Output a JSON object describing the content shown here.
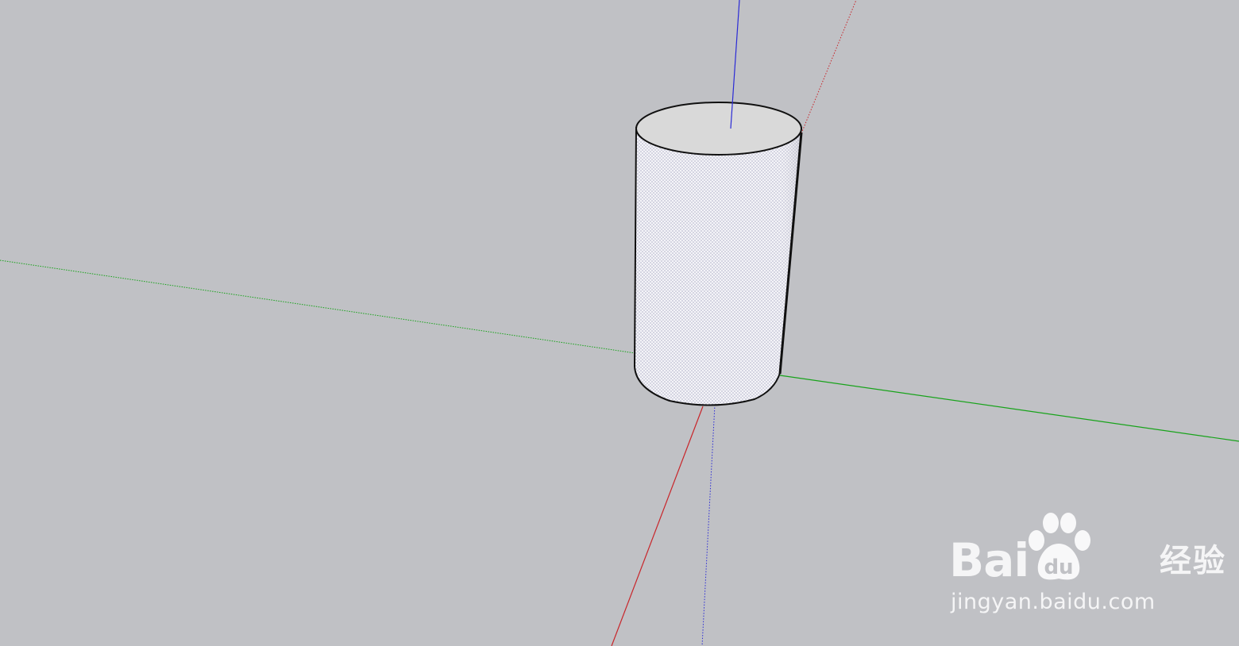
{
  "app": {
    "name": "SketchUp 3D modeling viewport"
  },
  "scene": {
    "background_color": "#c0c1c5",
    "axes": {
      "red_axis_color": "#c8252a",
      "green_axis_color": "#17a31a",
      "blue_axis_color": "#2a2ad6"
    },
    "object": {
      "type": "cylinder",
      "top_face_color": "#d9d9d9",
      "side_face_color": "#f4f4f8",
      "edge_color": "#101010"
    }
  },
  "watermark": {
    "brand_left": "Bai",
    "brand_right": "du",
    "brand_cn": "经验",
    "url": "jingyan.baidu.com",
    "color": "#ffffff"
  }
}
